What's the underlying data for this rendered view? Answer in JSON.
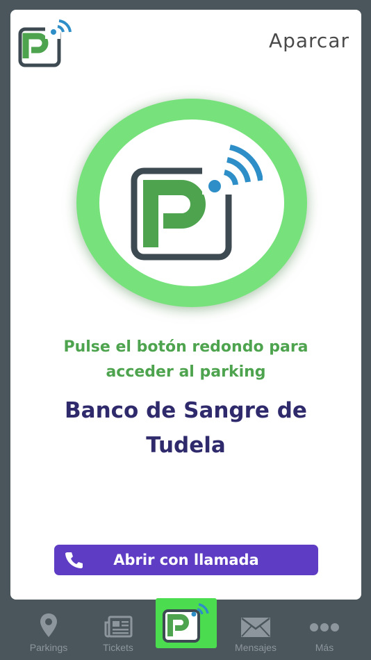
{
  "header": {
    "title": "Aparcar",
    "logo_icon": "parking-wifi-logo-icon"
  },
  "main": {
    "instruction": "Pulse el botón redondo para acceder al parking",
    "parking_name": "Banco de Sangre de Tudela",
    "call_button_label": "Abrir con llamada"
  },
  "tabs": [
    {
      "label": "Parkings",
      "icon": "location-pin-icon"
    },
    {
      "label": "Tickets",
      "icon": "ticket-icon"
    },
    {
      "label": "",
      "icon": "parking-wifi-logo-icon",
      "active": true
    },
    {
      "label": "Mensajes",
      "icon": "envelope-icon"
    },
    {
      "label": "Más",
      "icon": "more-dots-icon"
    }
  ],
  "colors": {
    "ring": "#77e27c",
    "logo_green": "#4ea44e",
    "logo_frame": "#3d4a52",
    "wifi_blue": "#2e8fc8",
    "button_purple": "#5e3cc4",
    "title_navy": "#2f2a6b",
    "tab_active": "#4cdc4f"
  }
}
